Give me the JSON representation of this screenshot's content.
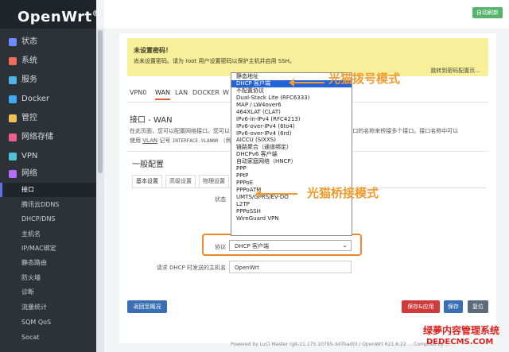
{
  "brand": {
    "name": "OpenWrt",
    "mark": "®"
  },
  "topbar": {
    "auto_refresh": "自动刷新"
  },
  "sidebar": {
    "items": [
      {
        "label": "状态",
        "icon": "home-icon",
        "color": "#6c8cff"
      },
      {
        "label": "系统",
        "icon": "tools-icon",
        "color": "#f26b5b"
      },
      {
        "label": "服务",
        "icon": "download-icon",
        "color": "#4fb3e8"
      },
      {
        "label": "Docker",
        "icon": "docker-icon",
        "color": "#3fa9f5"
      },
      {
        "label": "管控",
        "icon": "lock-icon",
        "color": "#f2c14e"
      },
      {
        "label": "网络存储",
        "icon": "storage-icon",
        "color": "#f25c8c"
      },
      {
        "label": "VPN",
        "icon": "vpn-icon",
        "color": "#4fc3d8"
      },
      {
        "label": "网络",
        "icon": "network-icon",
        "color": "#b46cff"
      }
    ],
    "sub_items": [
      {
        "label": "接口"
      },
      {
        "label": "腾讯云DDNS"
      },
      {
        "label": "DHCP/DNS"
      },
      {
        "label": "主机名"
      },
      {
        "label": "IP/MAC绑定"
      },
      {
        "label": "静态路由"
      },
      {
        "label": "防火墙"
      },
      {
        "label": "诊断"
      },
      {
        "label": "流量统计"
      },
      {
        "label": "SQM QoS"
      },
      {
        "label": "Socat"
      }
    ]
  },
  "warning": {
    "title": "未设置密码！",
    "text": "尚未设置密码。请为 root 用户设置密码以保护主机并启用 SSH。",
    "action": "跳转到密码配置页..."
  },
  "tabs": [
    "VPN0",
    "WAN",
    "LAN",
    "DOCKER",
    "W"
  ],
  "section": {
    "title": "接口 - WAN",
    "desc1": "在此页面，您可以配置网络接口。您可以勾选“桥接接口”，并输入由空格分隔的多个网络接口的名称来桥接多个接口。接口名称中可以",
    "desc2_prefix": "使用",
    "desc2_vlan": "VLAN",
    "desc2_mid": "记号",
    "desc2_code": "INTERFACE.VLANNR",
    "desc2_tail": "（例"
  },
  "general": {
    "title": "一般配置",
    "subtabs": [
      "基本设置",
      "高级设置",
      "物理设置"
    ]
  },
  "form": {
    "status_label": "状态",
    "protocol_label": "协议",
    "protocol_value": "DHCP 客户端",
    "hostname_label": "请求 DHCP 时发送的主机名",
    "hostname_value": "OpenWrt"
  },
  "dropdown": {
    "options": [
      "静态地址",
      "DHCP 客户端",
      "不配置协议",
      "Dual-Stack Lite (RFC6333)",
      "MAP / LW4over6",
      "464XLAT (CLAT)",
      "IPv6-in-IPv4 (RFC4213)",
      "IPv6-over-IPv4 (6to4)",
      "IPv6-over-IPv4 (6rd)",
      "AICCU (SIXXS)",
      "链路聚合（通道绑定）",
      "DHCPv6 客户端",
      "自动家庭网络（HNCP）",
      "PPP",
      "PPtP",
      "PPPoE",
      "PPPoATM",
      "UMTS/GPRS/EV-DO",
      "L2TP",
      "PPPoSSH",
      "WireGuard VPN"
    ],
    "selected": "DHCP 客户端"
  },
  "annotations": {
    "dial_mode": "光猫拨号模式",
    "bridge_mode": "光猫桥接模式"
  },
  "buttons": {
    "back": "返回至概况",
    "save_apply": "保存&应用",
    "save": "保存",
    "reset": "复位"
  },
  "footer": "Powered by LuCI Master (git-21.175.10795-3d7bad0) / OpenWrt R21.6.22 ... Compiled by ...",
  "watermark": {
    "line1": "绿夢内容管理系统",
    "line2": "DEDECMS.COM"
  }
}
